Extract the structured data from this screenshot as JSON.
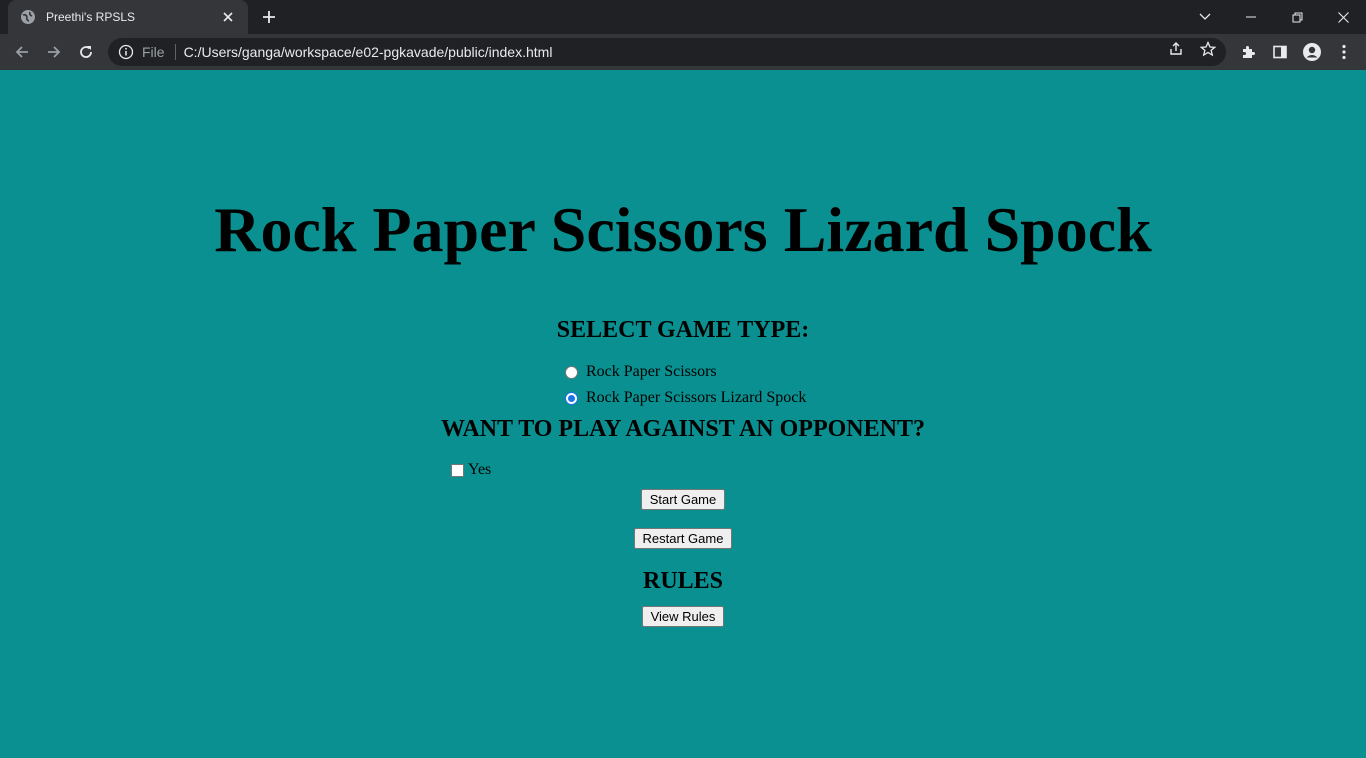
{
  "browser": {
    "tab_title": "Preethi's RPSLS",
    "file_label": "File",
    "url": "C:/Users/ganga/workspace/e02-pgkavade/public/index.html"
  },
  "page": {
    "title": "Rock Paper Scissors Lizard Spock",
    "game_type_heading": "SELECT GAME TYPE:",
    "game_types": [
      {
        "label": "Rock Paper Scissors",
        "checked": false
      },
      {
        "label": "Rock Paper Scissors Lizard Spock",
        "checked": true
      }
    ],
    "opponent_heading": "WANT TO PLAY AGAINST AN OPPONENT?",
    "opponent_option": {
      "label": "Yes",
      "checked": false
    },
    "start_button": "Start Game",
    "restart_button": "Restart Game",
    "rules_heading": "RULES",
    "view_rules_button": "View Rules"
  },
  "colors": {
    "page_background": "#0a9090",
    "titlebar": "#202124",
    "toolbar": "#35363a",
    "radio_accent": "#1a73e8"
  },
  "icons": {
    "tab_favicon": "globe-icon",
    "tab_close": "close-icon",
    "new_tab": "plus-icon",
    "back": "arrow-left-icon",
    "forward": "arrow-right-icon",
    "reload": "reload-icon",
    "site_info": "info-icon",
    "share": "share-icon",
    "bookmark": "star-icon",
    "extensions": "puzzle-icon",
    "side_panel": "side-panel-icon",
    "profile": "profile-icon",
    "menu": "kebab-menu-icon",
    "tab_search": "chevron-down-icon",
    "minimize": "minimize-icon",
    "restore": "restore-icon",
    "close_window": "close-window-icon"
  }
}
